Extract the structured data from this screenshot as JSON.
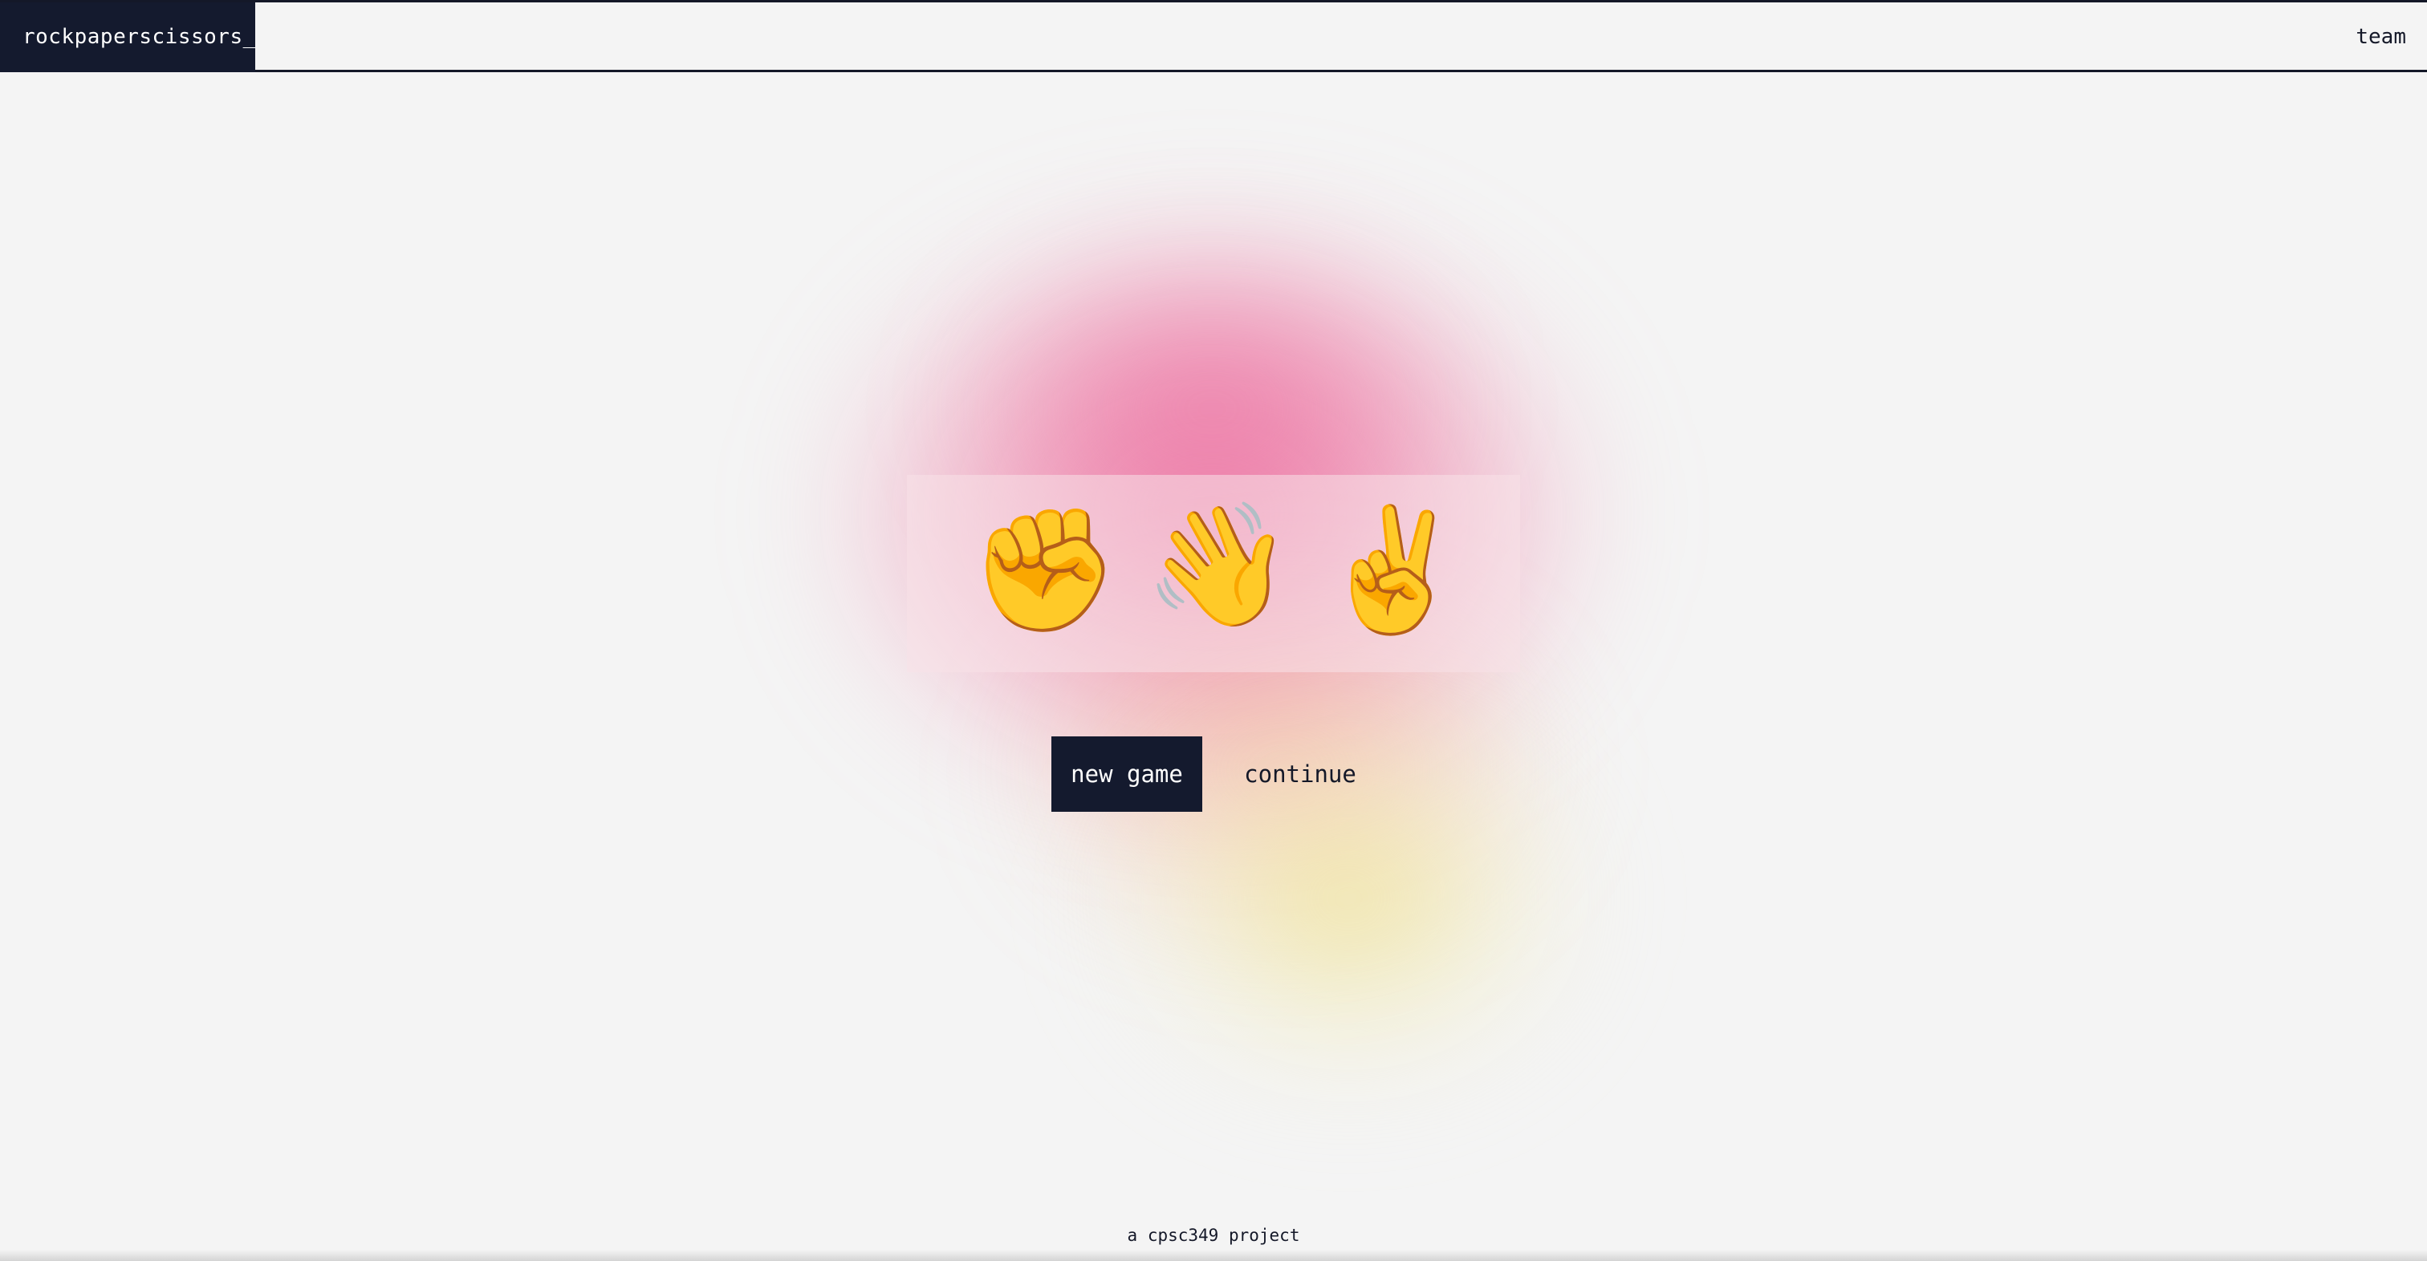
{
  "header": {
    "brand": "rockpaperscissors_",
    "nav_team": "team"
  },
  "hero": {
    "hands": [
      {
        "name": "rock",
        "glyph": "✊"
      },
      {
        "name": "paper",
        "glyph": "👋"
      },
      {
        "name": "scissors",
        "glyph": "✌️"
      }
    ]
  },
  "actions": {
    "new_game": "new game",
    "continue": "continue"
  },
  "footer": {
    "text": "a cpsc349 project"
  },
  "colors": {
    "primary": "#141a2e",
    "background": "#f4f4f4",
    "glow_pink": "#ec699b",
    "glow_yellow": "#f0e496"
  }
}
